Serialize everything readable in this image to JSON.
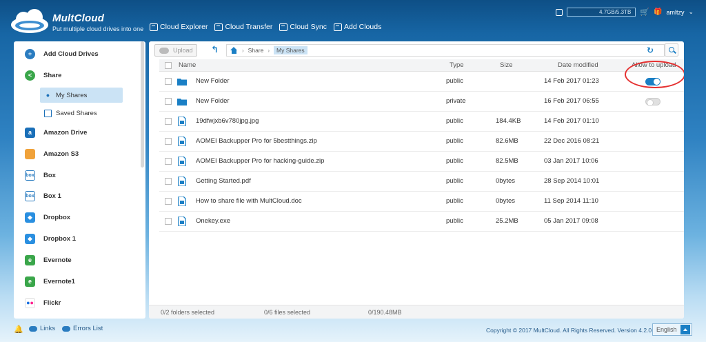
{
  "brand": {
    "name": "MultCloud",
    "tagline": "Put multiple cloud drives into one"
  },
  "nav": [
    {
      "label": "Cloud Explorer",
      "icon": "cloud-explorer-icon"
    },
    {
      "label": "Cloud Transfer",
      "icon": "cloud-transfer-icon"
    },
    {
      "label": "Cloud Sync",
      "icon": "cloud-sync-icon"
    },
    {
      "label": "Add Clouds",
      "icon": "add-clouds-icon"
    }
  ],
  "topbar": {
    "quota": "4.7GB/5.3TB",
    "username": "amltzy"
  },
  "sidebar": {
    "items": [
      {
        "label": "Add Cloud Drives",
        "icon": "add-cloud-icon",
        "color": "#2a7cc0"
      },
      {
        "label": "Share",
        "icon": "share-icon",
        "color": "#3aa64a"
      },
      {
        "label": "My Shares",
        "icon": "user-icon",
        "active": true
      },
      {
        "label": "Saved Shares",
        "icon": "saved-shares-icon"
      },
      {
        "label": "Amazon Drive",
        "icon": "amazon-drive-icon",
        "color": "#1a6fb8"
      },
      {
        "label": "Amazon S3",
        "icon": "amazon-s3-icon",
        "color": "#f0a23a"
      },
      {
        "label": "Box",
        "icon": "box-icon",
        "color": "#2a7cc0"
      },
      {
        "label": "Box 1",
        "icon": "box-icon",
        "color": "#2a7cc0"
      },
      {
        "label": "Dropbox",
        "icon": "dropbox-icon",
        "color": "#2a8fe0"
      },
      {
        "label": "Dropbox 1",
        "icon": "dropbox-icon",
        "color": "#2a8fe0"
      },
      {
        "label": "Evernote",
        "icon": "evernote-icon",
        "color": "#3aa64a"
      },
      {
        "label": "Evernote1",
        "icon": "evernote-icon",
        "color": "#3aa64a"
      },
      {
        "label": "Flickr",
        "icon": "flickr-icon",
        "color": "#1a1a1a"
      }
    ]
  },
  "toolbar": {
    "upload_label": "Upload",
    "crumbs": [
      "Share",
      "My Shares"
    ]
  },
  "table": {
    "headers": {
      "name": "Name",
      "type": "Type",
      "size": "Size",
      "date": "Date modified",
      "allow": "Allow to upload"
    },
    "rows": [
      {
        "name": "New Folder",
        "type": "public",
        "size": "",
        "date": "14 Feb 2017 01:23",
        "icon": "folder-icon",
        "allow_upload": true
      },
      {
        "name": "New Folder",
        "type": "private",
        "size": "",
        "date": "16 Feb 2017 06:55",
        "icon": "folder-icon",
        "allow_upload": false
      },
      {
        "name": "19dfwjxb6v780jpg.jpg",
        "type": "public",
        "size": "184.4KB",
        "date": "14 Feb 2017 01:10",
        "icon": "image-file-icon"
      },
      {
        "name": "AOMEI Backupper Pro for 5bestthings.zip",
        "type": "public",
        "size": "82.6MB",
        "date": "22 Dec 2016 08:21",
        "icon": "zip-file-icon"
      },
      {
        "name": "AOMEI Backupper Pro for hacking-guide.zip",
        "type": "public",
        "size": "82.5MB",
        "date": "03 Jan 2017 10:06",
        "icon": "zip-file-icon"
      },
      {
        "name": "Getting Started.pdf",
        "type": "public",
        "size": "0bytes",
        "date": "28 Sep 2014 10:01",
        "icon": "pdf-file-icon"
      },
      {
        "name": "How to share file with MultCloud.doc",
        "type": "public",
        "size": "0bytes",
        "date": "11 Sep 2014 11:10",
        "icon": "doc-file-icon"
      },
      {
        "name": "Onekey.exe",
        "type": "public",
        "size": "25.2MB",
        "date": "05 Jan 2017 09:08",
        "icon": "exe-file-icon"
      }
    ]
  },
  "status": {
    "folders": "0/2 folders selected",
    "files": "0/6 files selected",
    "size": "0/190.48MB"
  },
  "footer": {
    "links_label": "Links",
    "errors_label": "Errors List",
    "copyright": "Copyright © 2017 MultCloud. All Rights Reserved. Version 4.2.0",
    "language": "English"
  }
}
